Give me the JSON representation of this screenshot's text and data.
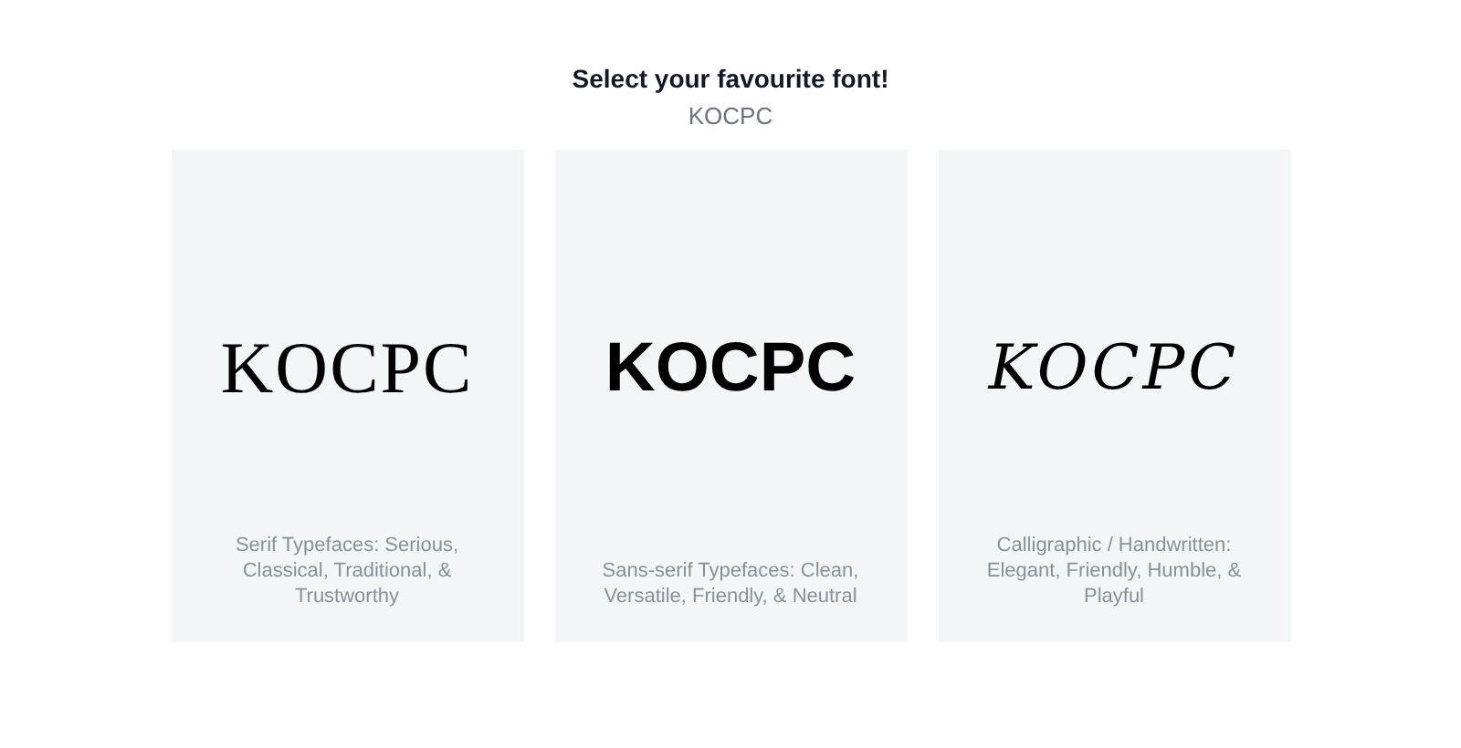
{
  "heading": "Select your favourite font!",
  "input": {
    "value": "KOCPC"
  },
  "cards": [
    {
      "kind": "serif",
      "sample": "KOCPC",
      "caption": "Serif Typefaces: Serious, Classical, Traditional, & Trustworthy"
    },
    {
      "kind": "sans",
      "sample": "KOCPC",
      "caption": "Sans-serif Typefaces: Clean, Versatile, Friendly, & Neutral"
    },
    {
      "kind": "calligraphic",
      "sample": "KOCPC",
      "caption": "Calligraphic / Handwritten: Elegant, Friendly, Humble, & Playful"
    }
  ]
}
